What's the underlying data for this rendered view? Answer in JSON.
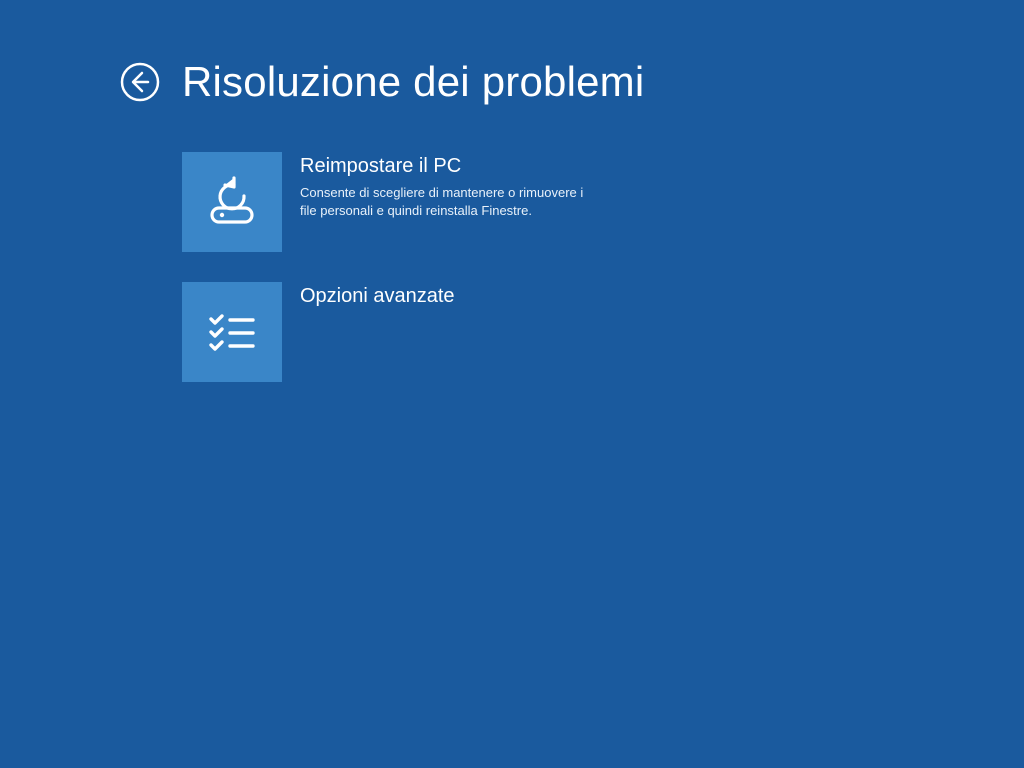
{
  "colors": {
    "background": "#1a5a9e",
    "tile": "#3a86c8",
    "text": "#ffffff"
  },
  "header": {
    "title": "Risoluzione dei problemi"
  },
  "options": [
    {
      "id": "reset-pc",
      "icon": "reset-pc-icon",
      "title": "Reimpostare il PC",
      "description": "Consente di scegliere di mantenere o rimuovere i file personali e quindi reinstalla Finestre."
    },
    {
      "id": "advanced-options",
      "icon": "advanced-options-icon",
      "title": "Opzioni avanzate",
      "description": ""
    }
  ]
}
